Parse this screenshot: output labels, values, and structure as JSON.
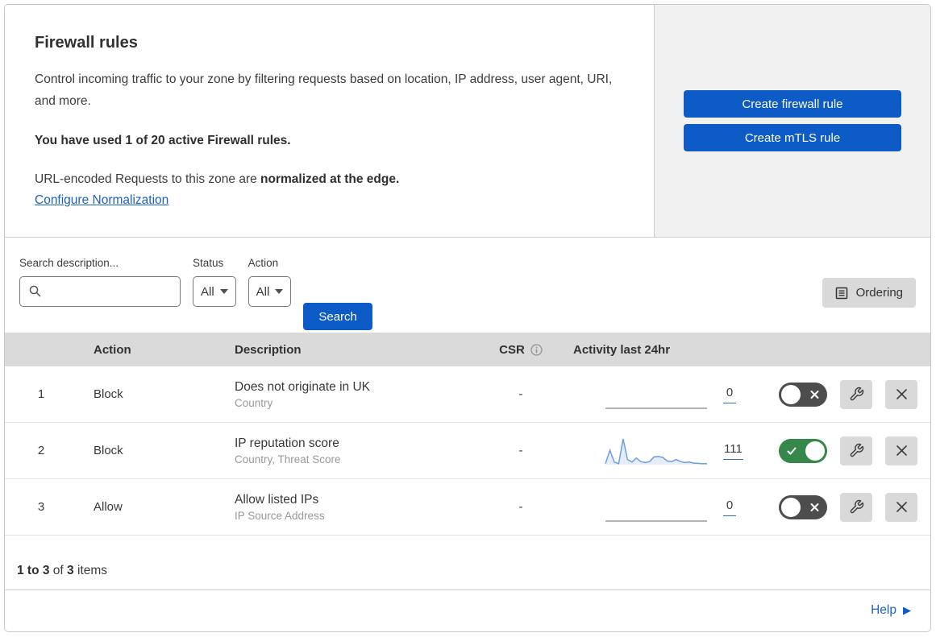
{
  "colors": {
    "accent_blue": "#0d5bc6",
    "link_blue": "#1b62c1",
    "toggle_on_green": "#35874a",
    "toggle_off_gray": "#4d4d4d",
    "sparkline_blue": "#6d9de2",
    "sparkline_flat_gray": "#9a9a9a",
    "table_header_gray": "#dadada"
  },
  "header": {
    "title": "Firewall rules",
    "description": "Control incoming traffic to your zone by filtering requests based on location, IP address, user agent, URI, and more.",
    "usage_line": "You have used 1 of 20 active Firewall rules.",
    "normalization_text": "URL-encoded Requests to this zone are ",
    "normalization_bold": "normalized at the edge.",
    "configure_link": "Configure Normalization",
    "create_firewall_button": "Create firewall rule",
    "create_mtls_button": "Create mTLS rule"
  },
  "filters": {
    "search_label": "Search description...",
    "search_placeholder": "",
    "status_label": "Status",
    "status_value": "All",
    "action_label": "Action",
    "action_value": "All",
    "search_button": "Search",
    "ordering_button": "Ordering"
  },
  "table": {
    "columns": {
      "action": "Action",
      "description": "Description",
      "csr": "CSR",
      "activity": "Activity last 24hr"
    },
    "rows": [
      {
        "priority": "1",
        "action": "Block",
        "description": "Does not originate in UK",
        "fields": "Country",
        "csr": "-",
        "activity_count": "0",
        "enabled": false,
        "sparkline": [
          0,
          0,
          0,
          0,
          0,
          0,
          0,
          0,
          0,
          0,
          0,
          0,
          0,
          0,
          0,
          0,
          0,
          0,
          0,
          0,
          0,
          0,
          0,
          0
        ]
      },
      {
        "priority": "2",
        "action": "Block",
        "description": "IP reputation score",
        "fields": "Country, Threat Score",
        "csr": "-",
        "activity_count": "111",
        "enabled": true,
        "sparkline": [
          4,
          56,
          10,
          4,
          100,
          20,
          10,
          26,
          12,
          8,
          12,
          30,
          32,
          28,
          14,
          12,
          20,
          12,
          8,
          10,
          6,
          5,
          4,
          4
        ]
      },
      {
        "priority": "3",
        "action": "Allow",
        "description": "Allow listed IPs",
        "fields": "IP Source Address",
        "csr": "-",
        "activity_count": "0",
        "enabled": false,
        "sparkline": [
          0,
          0,
          0,
          0,
          0,
          0,
          0,
          0,
          0,
          0,
          0,
          0,
          0,
          0,
          0,
          0,
          0,
          0,
          0,
          0,
          0,
          0,
          0,
          0
        ]
      }
    ]
  },
  "footer": {
    "range_bold": "1 to 3",
    "of_text": " of ",
    "total_bold": "3",
    "items_text": " items",
    "help_label": "Help"
  }
}
